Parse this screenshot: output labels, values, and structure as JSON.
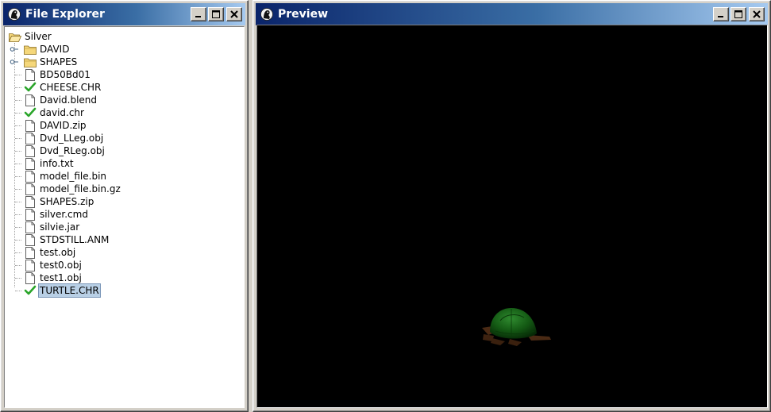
{
  "explorer": {
    "title": "File Explorer",
    "root": "Silver",
    "folders": [
      "DAVID",
      "SHAPES"
    ],
    "files": [
      {
        "name": "BD50Bd01",
        "checked": false
      },
      {
        "name": "CHEESE.CHR",
        "checked": true
      },
      {
        "name": "David.blend",
        "checked": false
      },
      {
        "name": "david.chr",
        "checked": true
      },
      {
        "name": "DAVID.zip",
        "checked": false
      },
      {
        "name": "Dvd_LLeg.obj",
        "checked": false
      },
      {
        "name": "Dvd_RLeg.obj",
        "checked": false
      },
      {
        "name": "info.txt",
        "checked": false
      },
      {
        "name": "model_file.bin",
        "checked": false
      },
      {
        "name": "model_file.bin.gz",
        "checked": false
      },
      {
        "name": "SHAPES.zip",
        "checked": false
      },
      {
        "name": "silver.cmd",
        "checked": false
      },
      {
        "name": "silvie.jar",
        "checked": false
      },
      {
        "name": "STDSTILL.ANM",
        "checked": false
      },
      {
        "name": "test.obj",
        "checked": false
      },
      {
        "name": "test0.obj",
        "checked": false
      },
      {
        "name": "test1.obj",
        "checked": false
      },
      {
        "name": "TURTLE.CHR",
        "checked": true,
        "selected": true
      }
    ]
  },
  "preview": {
    "title": "Preview",
    "background": "#000000",
    "model": "turtle"
  },
  "colors": {
    "title_gradient_start": "#0a246a",
    "title_gradient_end": "#a6caf0",
    "check_green": "#2aa52a",
    "folder_yellow": "#f5d77a",
    "selection": "#b8cfe5"
  }
}
